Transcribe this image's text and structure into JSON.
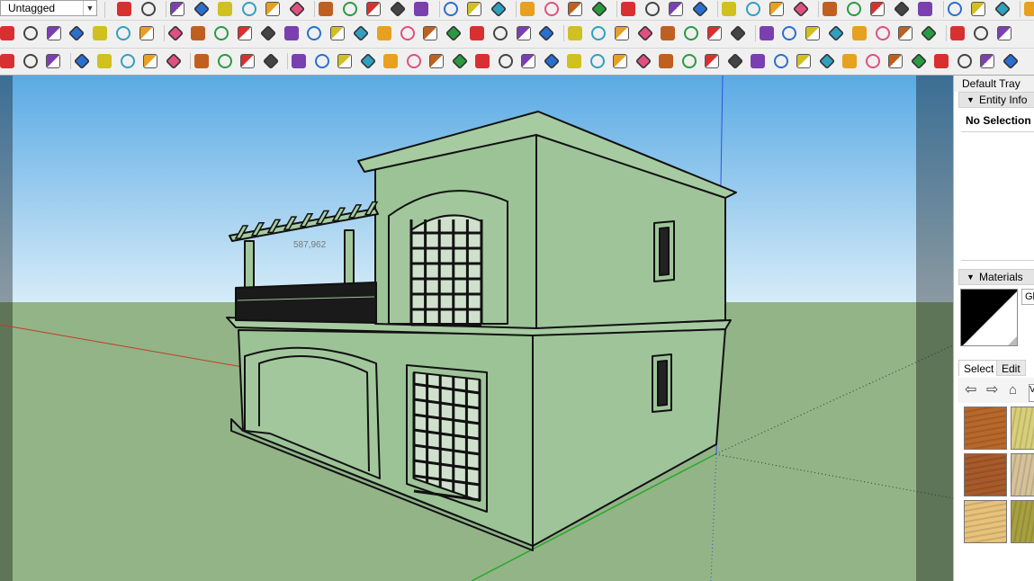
{
  "toolbar": {
    "tag_selector": {
      "value": "Untagged"
    }
  },
  "tray": {
    "title": "Default Tray",
    "entity_info": {
      "header": "Entity Info",
      "status": "No Selection"
    },
    "materials": {
      "header": "Materials",
      "name_field": "Gl",
      "tabs": [
        "Select",
        "Edit"
      ],
      "library_field": "V",
      "swatches": [
        {
          "name": "wood-swatch-1",
          "color": "#b8682a"
        },
        {
          "name": "beige-swatch-1",
          "color": "#d8cf7a"
        },
        {
          "name": "wood-swatch-2",
          "color": "#a85a2a"
        },
        {
          "name": "beige-swatch-2",
          "color": "#d6c29a"
        },
        {
          "name": "cork-swatch",
          "color": "#e8c27a"
        },
        {
          "name": "olive-swatch",
          "color": "#a8a040"
        }
      ]
    }
  },
  "colors": {
    "sky_top": "#66b2e6",
    "sky_bottom": "#cfe8f7",
    "ground": "#93b487",
    "house_fill": "#9fc49a",
    "house_front": "#98bf92",
    "line": "#1a1a1a",
    "axis_red": "#c43c2c",
    "axis_green": "#2aa830",
    "axis_blue": "#3050e0",
    "frame_dark": "#5a6a5a"
  }
}
